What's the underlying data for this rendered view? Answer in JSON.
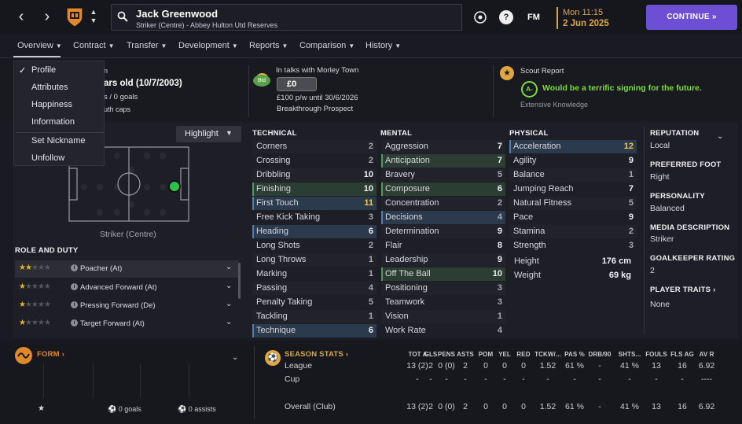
{
  "header": {
    "player_name": "Jack Greenwood",
    "player_sub": "Striker (Centre) - Abbey Hulton Utd Reserves",
    "fm_label": "FM",
    "date_time": "Mon 11:15",
    "date": "2 Jun 2025",
    "continue_label": "CONTINUE"
  },
  "tabs": [
    {
      "label": "Overview"
    },
    {
      "label": "Contract"
    },
    {
      "label": "Transfer"
    },
    {
      "label": "Development"
    },
    {
      "label": "Reports"
    },
    {
      "label": "Comparison"
    },
    {
      "label": "History"
    }
  ],
  "menu": [
    "Profile",
    "Attributes",
    "Happiness",
    "Information",
    "Set Nickname",
    "Unfollow"
  ],
  "info": {
    "age_line_partial": "n",
    "age": "ars old (10/7/2003)",
    "goals": "s / 0 goals",
    "caps": "uth caps",
    "transfer_status": "In talks with Morley Town",
    "bid_badge": "Bid",
    "value": "£0",
    "wage": "£100 p/w until 30/6/2026",
    "prospect": "Breakthrough Prospect",
    "scout_title": "Scout Report",
    "scout_grade": "A-",
    "scout_text": "Would be a terrific signing for the future.",
    "scout_knowledge": "Extensive Knowledge"
  },
  "pitch": {
    "highlight_label": "Highlight",
    "position_label": "Striker (Centre)"
  },
  "role_duty": {
    "title": "ROLE AND DUTY",
    "roles": [
      {
        "name": "Poacher (At)",
        "stars": 1.5
      },
      {
        "name": "Advanced Forward (At)",
        "stars": 1
      },
      {
        "name": "Pressing Forward (De)",
        "stars": 0.5
      },
      {
        "name": "Target Forward (At)",
        "stars": 0.5
      }
    ]
  },
  "technical": {
    "title": "TECHNICAL",
    "attrs": [
      {
        "name": "Corners",
        "value": "2"
      },
      {
        "name": "Crossing",
        "value": "2"
      },
      {
        "name": "Dribbling",
        "value": "10"
      },
      {
        "name": "Finishing",
        "value": "10"
      },
      {
        "name": "First Touch",
        "value": "11"
      },
      {
        "name": "Free Kick Taking",
        "value": "3"
      },
      {
        "name": "Heading",
        "value": "6"
      },
      {
        "name": "Long Shots",
        "value": "2"
      },
      {
        "name": "Long Throws",
        "value": "1"
      },
      {
        "name": "Marking",
        "value": "1"
      },
      {
        "name": "Passing",
        "value": "4"
      },
      {
        "name": "Penalty Taking",
        "value": "5"
      },
      {
        "name": "Tackling",
        "value": "1"
      },
      {
        "name": "Technique",
        "value": "6"
      }
    ]
  },
  "mental": {
    "title": "MENTAL",
    "attrs": [
      {
        "name": "Aggression",
        "value": "7"
      },
      {
        "name": "Anticipation",
        "value": "7"
      },
      {
        "name": "Bravery",
        "value": "5"
      },
      {
        "name": "Composure",
        "value": "6"
      },
      {
        "name": "Concentration",
        "value": "2"
      },
      {
        "name": "Decisions",
        "value": "4"
      },
      {
        "name": "Determination",
        "value": "9"
      },
      {
        "name": "Flair",
        "value": "8"
      },
      {
        "name": "Leadership",
        "value": "9"
      },
      {
        "name": "Off The Ball",
        "value": "10"
      },
      {
        "name": "Positioning",
        "value": "3"
      },
      {
        "name": "Teamwork",
        "value": "3"
      },
      {
        "name": "Vision",
        "value": "1"
      },
      {
        "name": "Work Rate",
        "value": "4"
      }
    ]
  },
  "physical": {
    "title": "PHYSICAL",
    "attrs": [
      {
        "name": "Acceleration",
        "value": "12"
      },
      {
        "name": "Agility",
        "value": "9"
      },
      {
        "name": "Balance",
        "value": "1"
      },
      {
        "name": "Jumping Reach",
        "value": "7"
      },
      {
        "name": "Natural Fitness",
        "value": "5"
      },
      {
        "name": "Pace",
        "value": "9"
      },
      {
        "name": "Stamina",
        "value": "2"
      },
      {
        "name": "Strength",
        "value": "3"
      }
    ],
    "height_label": "Height",
    "height": "176 cm",
    "weight_label": "Weight",
    "weight": "69 kg"
  },
  "side": {
    "reputation_title": "REPUTATION",
    "reputation": "Local",
    "foot_title": "PREFERRED FOOT",
    "foot": "Right",
    "personality_title": "PERSONALITY",
    "personality": "Balanced",
    "media_title": "MEDIA DESCRIPTION",
    "media": "Striker",
    "gk_title": "GOALKEEPER RATING",
    "gk": "2",
    "traits_title": "PLAYER TRAITS",
    "traits": "None"
  },
  "form": {
    "title": "FORM",
    "goals": "0 goals",
    "assists": "0 assists"
  },
  "season": {
    "title": "SEASON STATS",
    "headers": [
      "TOT A...",
      "GLS",
      "PENS",
      "ASTS",
      "POM",
      "YEL",
      "RED",
      "TCKW/...",
      "PAS %",
      "DRB/90",
      "SHTS...",
      "FOULS",
      "FLS AG",
      "AV R"
    ],
    "rows": [
      {
        "label": "League",
        "cells": [
          "13 (2)",
          "2",
          "0 (0)",
          "2",
          "0",
          "0",
          "0",
          "1.52",
          "61 %",
          "-",
          "41 %",
          "13",
          "16",
          "6.92"
        ]
      },
      {
        "label": "Cup",
        "cells": [
          "-",
          "-",
          "-",
          "-",
          "-",
          "-",
          "-",
          "-",
          "-",
          "-",
          "-",
          "-",
          "-",
          "----"
        ]
      },
      {
        "label": "Overall (Club)",
        "cells": [
          "13 (2)",
          "2",
          "0 (0)",
          "2",
          "0",
          "0",
          "0",
          "1.52",
          "61 %",
          "-",
          "41 %",
          "13",
          "16",
          "6.92"
        ]
      }
    ]
  },
  "colors": {
    "accent": "#6c4fd4",
    "date": "#e0a63f",
    "scout_green": "#7cdc3a",
    "highlight_green": "#2f4a3a",
    "highlight_blue": "#2e4257"
  }
}
